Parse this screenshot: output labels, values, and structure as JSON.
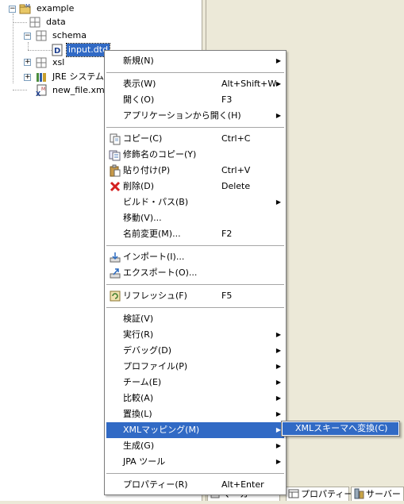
{
  "tree": {
    "root": "example",
    "children": [
      "data",
      "schema",
      "input.dtd",
      "xsl",
      "JRE システム",
      "new_file.xmf"
    ]
  },
  "menu": {
    "items": [
      {
        "label": "新規(N)",
        "accel": "",
        "submenu": true,
        "icon": ""
      },
      {
        "label": "表示(W)",
        "accel": "Alt+Shift+W",
        "submenu": true,
        "icon": ""
      },
      {
        "label": "開く(O)",
        "accel": "F3",
        "submenu": false,
        "icon": ""
      },
      {
        "label": "アプリケーションから開く(H)",
        "accel": "",
        "submenu": true,
        "icon": ""
      },
      {
        "label": "コピー(C)",
        "accel": "Ctrl+C",
        "submenu": false,
        "icon": "copy-icon"
      },
      {
        "label": "修飾名のコピー(Y)",
        "accel": "",
        "submenu": false,
        "icon": "copy-qualified-name-icon"
      },
      {
        "label": "貼り付け(P)",
        "accel": "Ctrl+V",
        "submenu": false,
        "icon": "paste-icon"
      },
      {
        "label": "削除(D)",
        "accel": "Delete",
        "submenu": false,
        "icon": "delete-icon"
      },
      {
        "label": "ビルド・パス(B)",
        "accel": "",
        "submenu": true,
        "icon": ""
      },
      {
        "label": "移動(V)...",
        "accel": "",
        "submenu": false,
        "icon": ""
      },
      {
        "label": "名前変更(M)...",
        "accel": "F2",
        "submenu": false,
        "icon": ""
      },
      {
        "label": "インポート(I)...",
        "accel": "",
        "submenu": false,
        "icon": "import-icon"
      },
      {
        "label": "エクスポート(O)...",
        "accel": "",
        "submenu": false,
        "icon": "export-icon"
      },
      {
        "label": "リフレッシュ(F)",
        "accel": "F5",
        "submenu": false,
        "icon": "refresh-icon"
      },
      {
        "label": "検証(V)",
        "accel": "",
        "submenu": false,
        "icon": ""
      },
      {
        "label": "実行(R)",
        "accel": "",
        "submenu": true,
        "icon": ""
      },
      {
        "label": "デバッグ(D)",
        "accel": "",
        "submenu": true,
        "icon": ""
      },
      {
        "label": "プロファイル(P)",
        "accel": "",
        "submenu": true,
        "icon": ""
      },
      {
        "label": "チーム(E)",
        "accel": "",
        "submenu": true,
        "icon": ""
      },
      {
        "label": "比較(A)",
        "accel": "",
        "submenu": true,
        "icon": ""
      },
      {
        "label": "置換(L)",
        "accel": "",
        "submenu": true,
        "icon": ""
      },
      {
        "label": "XMLマッピング(M)",
        "accel": "",
        "submenu": true,
        "icon": ""
      },
      {
        "label": "生成(G)",
        "accel": "",
        "submenu": true,
        "icon": ""
      },
      {
        "label": "JPA ツール",
        "accel": "",
        "submenu": true,
        "icon": ""
      },
      {
        "label": "プロパティー(R)",
        "accel": "Alt+Enter",
        "submenu": false,
        "icon": ""
      }
    ],
    "highlighted": "XMLマッピング(M)"
  },
  "submenu": {
    "item": "XMLスキーマへ変換(C)"
  },
  "bottom_tabs": [
    "マーカー",
    "プロパティー",
    "サーバー"
  ],
  "colors": {
    "highlight": "#316ac5",
    "panel_bg": "#ece9d8"
  }
}
